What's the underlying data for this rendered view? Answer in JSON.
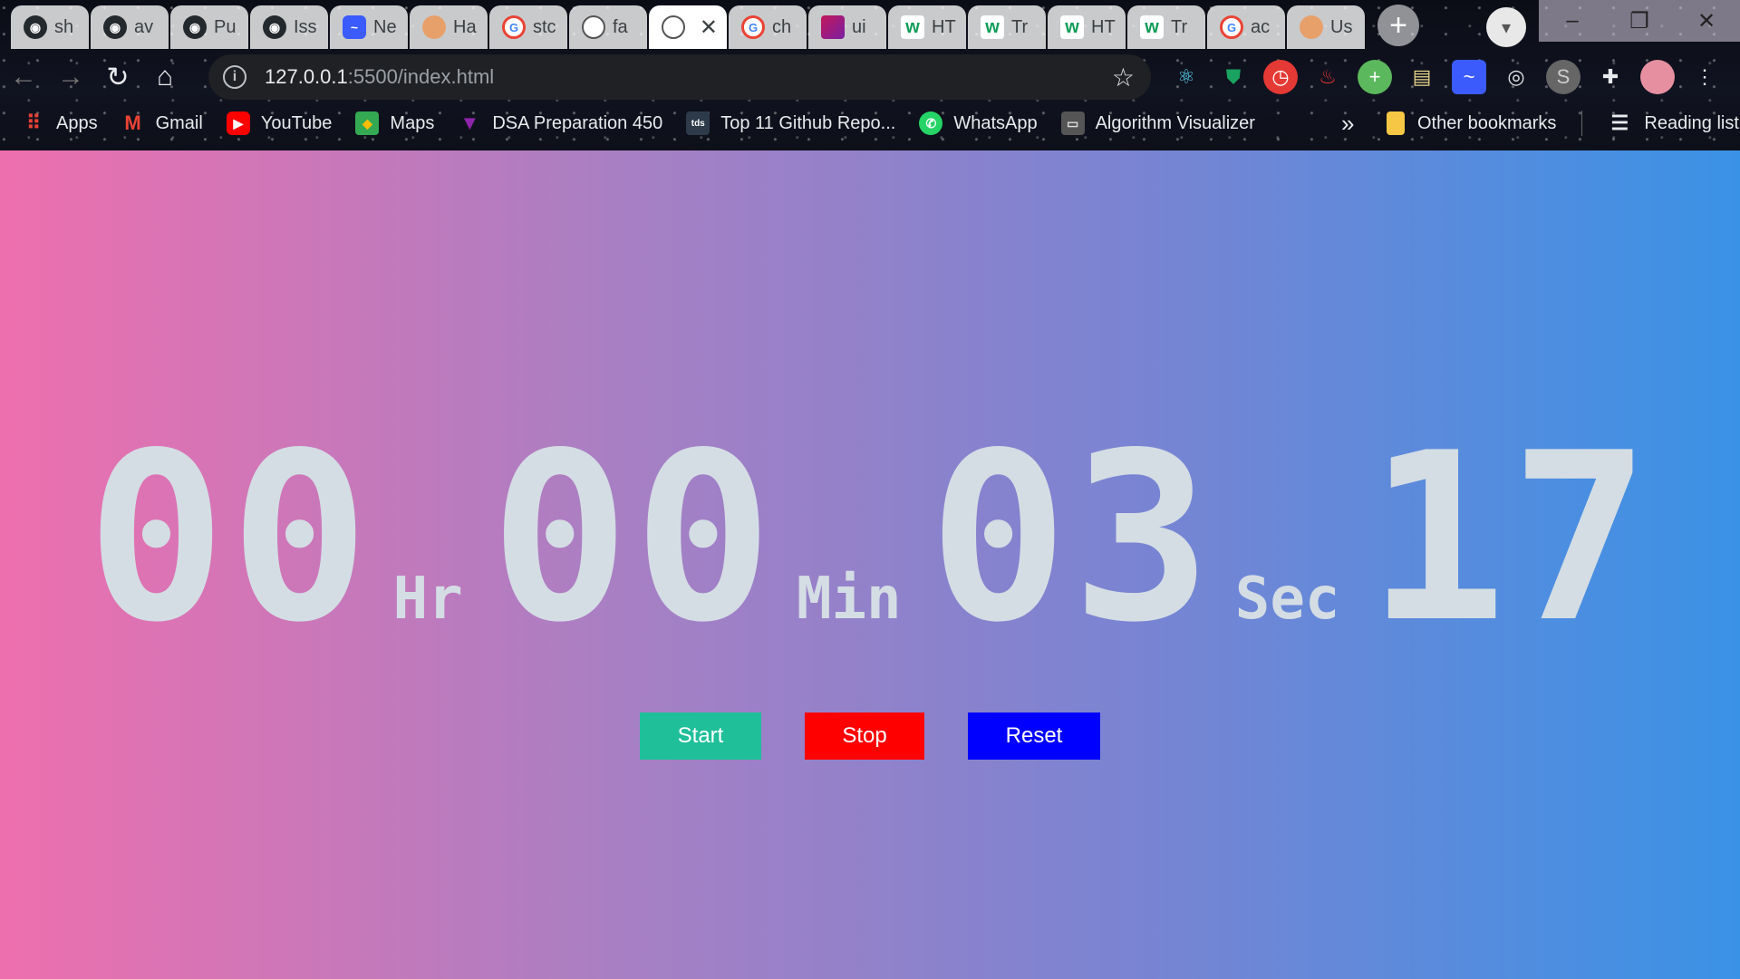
{
  "tabs": [
    {
      "title": "sh",
      "icon": "github-icon"
    },
    {
      "title": "av",
      "icon": "github-icon"
    },
    {
      "title": "Pu",
      "icon": "github-icon"
    },
    {
      "title": "Iss",
      "icon": "github-icon"
    },
    {
      "title": "Ne",
      "icon": "messenger-icon"
    },
    {
      "title": "Ha",
      "icon": "picture-icon"
    },
    {
      "title": "stc",
      "icon": "google-icon"
    },
    {
      "title": "fa",
      "icon": "stopwatch-icon"
    },
    {
      "title": "",
      "icon": "stopwatch-icon",
      "active": true
    },
    {
      "title": "ch",
      "icon": "google-icon"
    },
    {
      "title": "ui",
      "icon": "gradient-icon"
    },
    {
      "title": "HT",
      "icon": "w3schools-icon"
    },
    {
      "title": "Tr",
      "icon": "w3schools-icon"
    },
    {
      "title": "HT",
      "icon": "w3schools-icon"
    },
    {
      "title": "Tr",
      "icon": "w3schools-icon"
    },
    {
      "title": "ac",
      "icon": "google-icon"
    },
    {
      "title": "Us",
      "icon": "picture-icon"
    }
  ],
  "toolbar": {
    "url_host": "127.0.0.1",
    "url_path": ":5500/index.html"
  },
  "bookmarks": [
    {
      "label": "Apps",
      "icon": "apps-grid-icon"
    },
    {
      "label": "Gmail",
      "icon": "gmail-icon"
    },
    {
      "label": "YouTube",
      "icon": "youtube-icon"
    },
    {
      "label": "Maps",
      "icon": "maps-icon"
    },
    {
      "label": "DSA Preparation 450",
      "icon": "dsa-icon"
    },
    {
      "label": "Top 11 Github Repo...",
      "icon": "tds-icon"
    },
    {
      "label": "WhatsApp",
      "icon": "whatsapp-icon"
    },
    {
      "label": "Algorithm Visualizer",
      "icon": "keyboard-icon"
    }
  ],
  "bookmarks_extra": {
    "more": "»",
    "other": "Other bookmarks",
    "reading_list": "Reading list"
  },
  "stopwatch": {
    "hours": "00",
    "hours_unit": "Hr",
    "minutes": "00",
    "minutes_unit": "Min",
    "seconds": "03",
    "seconds_unit": "Sec",
    "centiseconds": "17"
  },
  "controls": {
    "start": "Start",
    "stop": "Stop",
    "reset": "Reset"
  },
  "colors": {
    "start": "#1fbf9a",
    "stop": "#ff0000",
    "reset": "#0000ff",
    "gradient_left": "#ee6fae",
    "gradient_right": "#3a92e6",
    "digits": "#d4dde4"
  }
}
